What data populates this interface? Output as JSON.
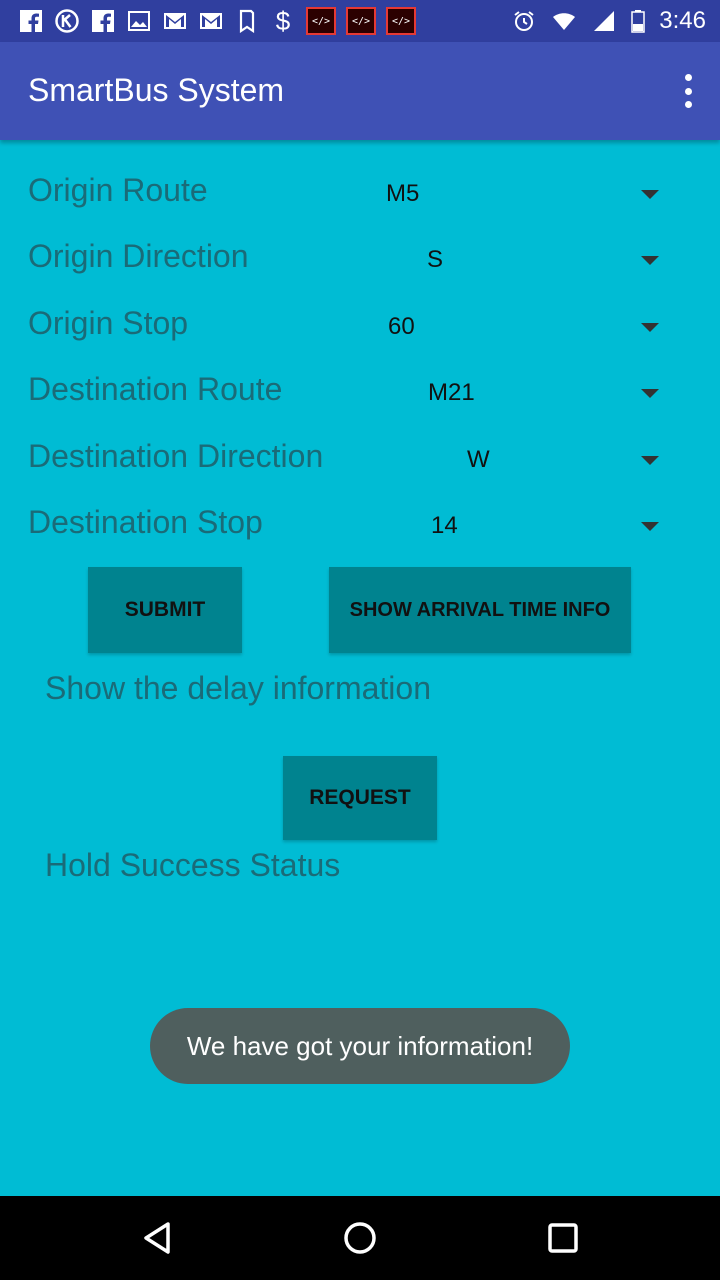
{
  "status_bar": {
    "time": "3:46",
    "icons": [
      "facebook-icon",
      "k-icon",
      "facebook-icon",
      "image-icon",
      "gmail-icon",
      "gmail-icon",
      "bookmark-icon",
      "dollar-icon",
      "code-icon",
      "code-icon",
      "code-icon"
    ],
    "dollar": "$",
    "code_glyph": "</>"
  },
  "app_bar": {
    "title": "SmartBus System"
  },
  "form": {
    "rows": [
      {
        "label": "Origin Route",
        "value": "M5"
      },
      {
        "label": "Origin Direction",
        "value": "S"
      },
      {
        "label": "Origin Stop",
        "value": "60"
      },
      {
        "label": "Destination Route",
        "value": "M21"
      },
      {
        "label": "Destination Direction",
        "value": "W"
      },
      {
        "label": "Destination Stop",
        "value": "14"
      }
    ]
  },
  "buttons": {
    "submit": "SUBMIT",
    "arrival": "SHOW ARRIVAL TIME INFO",
    "request": "REQUEST"
  },
  "texts": {
    "delay": "Show the delay information",
    "hold": "Hold Success Status"
  },
  "toast": {
    "message": "We have got your information!"
  },
  "colors": {
    "status_bar": "#303F9F",
    "app_bar": "#3F51B5",
    "background": "#00BCD4",
    "button": "#00838F",
    "toast": "#4F5F5E"
  }
}
